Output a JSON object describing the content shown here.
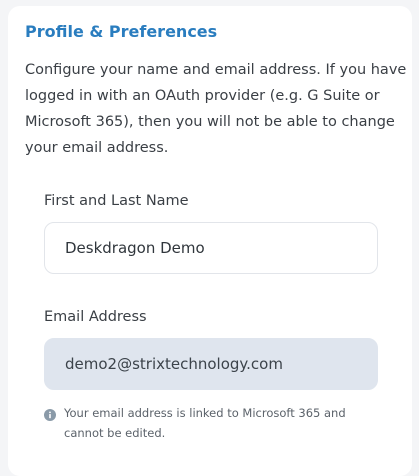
{
  "section": {
    "title": "Profile & Preferences",
    "description": "Configure your name and email address. If you have logged in with an OAuth provider (e.g. G Suite or Microsoft 365), then you will not be able to change your email address."
  },
  "fields": {
    "name": {
      "label": "First and Last Name",
      "value": "Deskdragon Demo"
    },
    "email": {
      "label": "Email Address",
      "value": "demo2@strixtechnology.com",
      "note": "Your email address is linked to Microsoft 365 and cannot be edited.",
      "note_icon": "info-icon"
    }
  },
  "colors": {
    "accent": "#2a7dbf",
    "disabled_bg": "#dfe5ee",
    "info_icon": "#8a9aa8"
  }
}
